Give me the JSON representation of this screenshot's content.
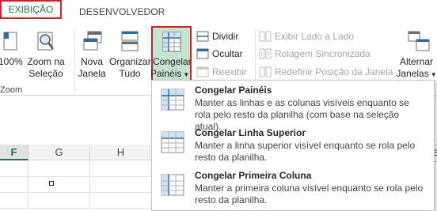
{
  "tabs": {
    "active": "EXIBIÇÃO",
    "next": "DESENVOLVEDOR"
  },
  "colors": {
    "accent": "#217346",
    "highlight_border": "#d0202a",
    "selected_bg": "#c5e4cf"
  },
  "ribbon": {
    "zoom100": "100%",
    "zoom_selection": [
      "Zoom na",
      "Seleção"
    ],
    "group_zoom": "Zoom",
    "new_window": [
      "Nova",
      "Janela"
    ],
    "arrange_all": [
      "Organizar",
      "Tudo"
    ],
    "freeze_panes": [
      "Congelar",
      "Painéis"
    ],
    "split": "Dividir",
    "hide": "Ocultar",
    "unhide": "Reexibir",
    "side_by_side": "Exibir Lado a Lado",
    "sync_scroll": "Rolagem Sincronizada",
    "reset_window": "Redefinir Posição da Janela",
    "switch_windows": [
      "Alternar",
      "Janelas"
    ]
  },
  "menu": {
    "items": [
      {
        "title": "Congelar Painéis",
        "desc": "Manter as linhas e as colunas visíveis enquanto se rola pelo resto da planilha (com base na seleção atual).",
        "icon": "freeze-panes-icon"
      },
      {
        "title": "Congelar Linha Superior",
        "desc": "Manter a linha superior visível enquanto se rola pelo resto da planilha.",
        "icon": "freeze-top-row-icon"
      },
      {
        "title": "Congelar Primeira Coluna",
        "desc": "Manter a primeira coluna visível enquanto se rola pelo resto da planilha.",
        "icon": "freeze-first-column-icon"
      }
    ]
  },
  "sheet": {
    "columns": [
      "F",
      "G",
      "H"
    ],
    "right_edge": "B"
  }
}
